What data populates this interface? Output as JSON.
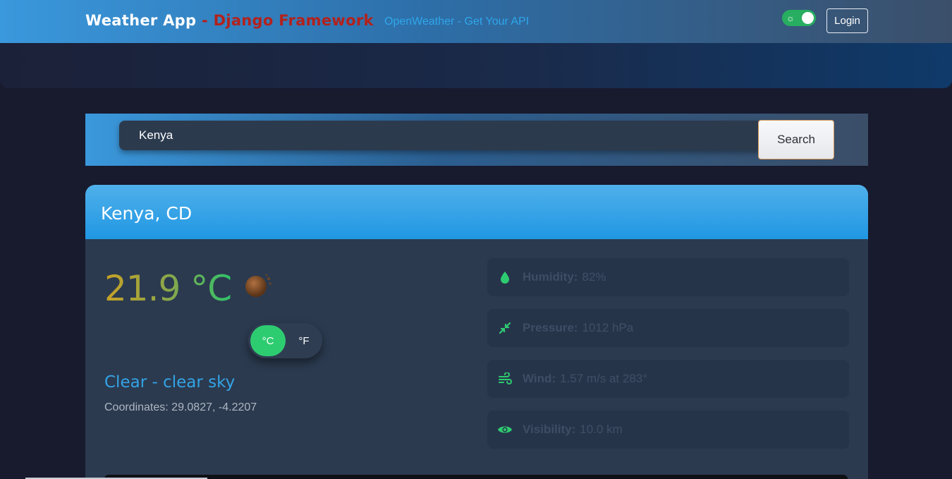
{
  "navbar": {
    "brand_main": "Weather App",
    "brand_accent": "- Django Framework",
    "api_link": "OpenWeather - Get Your API",
    "theme_icon": "sun-icon",
    "login_label": "Login"
  },
  "search": {
    "value": "Kenya",
    "button_label": "Search"
  },
  "weather": {
    "city": "Kenya, CD",
    "temperature": "21.9 °C",
    "icon": "clear-sky-icon",
    "unit_c": "°C",
    "unit_f": "°F",
    "selected_unit": "°C",
    "condition": "Clear - clear sky",
    "coordinates": "Coordinates: 29.0827, -4.2207"
  },
  "stats": [
    {
      "icon": "droplet-icon",
      "label": "Humidity:",
      "value": "82%"
    },
    {
      "icon": "compress-icon",
      "label": "Pressure:",
      "value": "1012 hPa"
    },
    {
      "icon": "wind-icon",
      "label": "Wind:",
      "value": "1.57 m/s at 283°"
    },
    {
      "icon": "eye-icon",
      "label": "Visibility:",
      "value": "10.0 km"
    }
  ],
  "colors": {
    "brand_accent": "#b3211c",
    "link": "#2fa6ea",
    "success": "#2ecc71",
    "header_blue": "#2097e3",
    "background": "#181a2e"
  }
}
